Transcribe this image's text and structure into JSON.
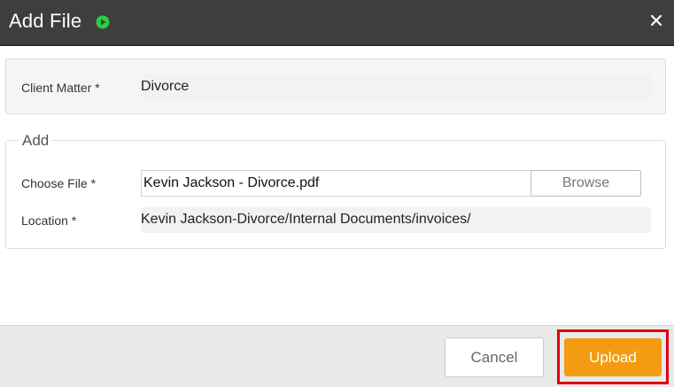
{
  "header": {
    "title": "Add File",
    "play_icon": "play-circle-icon",
    "close_icon": "close-icon",
    "accent_color": "#2ecc40"
  },
  "client_matter": {
    "label": "Client Matter *",
    "value": "Divorce"
  },
  "add_section": {
    "legend": "Add",
    "choose_file": {
      "label": "Choose File *",
      "value": "Kevin Jackson - Divorce.pdf",
      "browse_label": "Browse"
    },
    "location": {
      "label": "Location *",
      "value": "Kevin Jackson-Divorce/Internal Documents/invoices/"
    }
  },
  "footer": {
    "cancel_label": "Cancel",
    "upload_label": "Upload",
    "upload_color": "#f39c12",
    "highlight_color": "#e0000f"
  }
}
